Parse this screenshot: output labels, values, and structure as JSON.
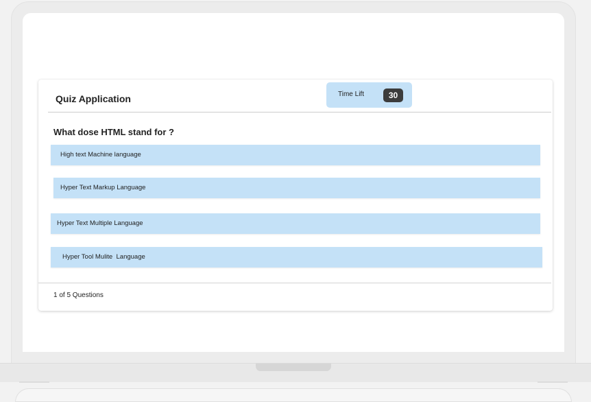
{
  "quiz": {
    "title": "Quiz Application",
    "timer": {
      "label": "Time Lift",
      "count": "30"
    },
    "question": "What dose HTML stand for ?",
    "options": [
      "High text Machine language",
      "Hyper Text Markup Language",
      "Hyper Text Multiple Language",
      "Hyper Tool Mulite  Language"
    ],
    "progress": "1 of 5 Questions"
  },
  "colors": {
    "option_bg": "#c4e1f7",
    "timer_badge": "#3c3c3c",
    "card_bg": "#ffffff"
  }
}
